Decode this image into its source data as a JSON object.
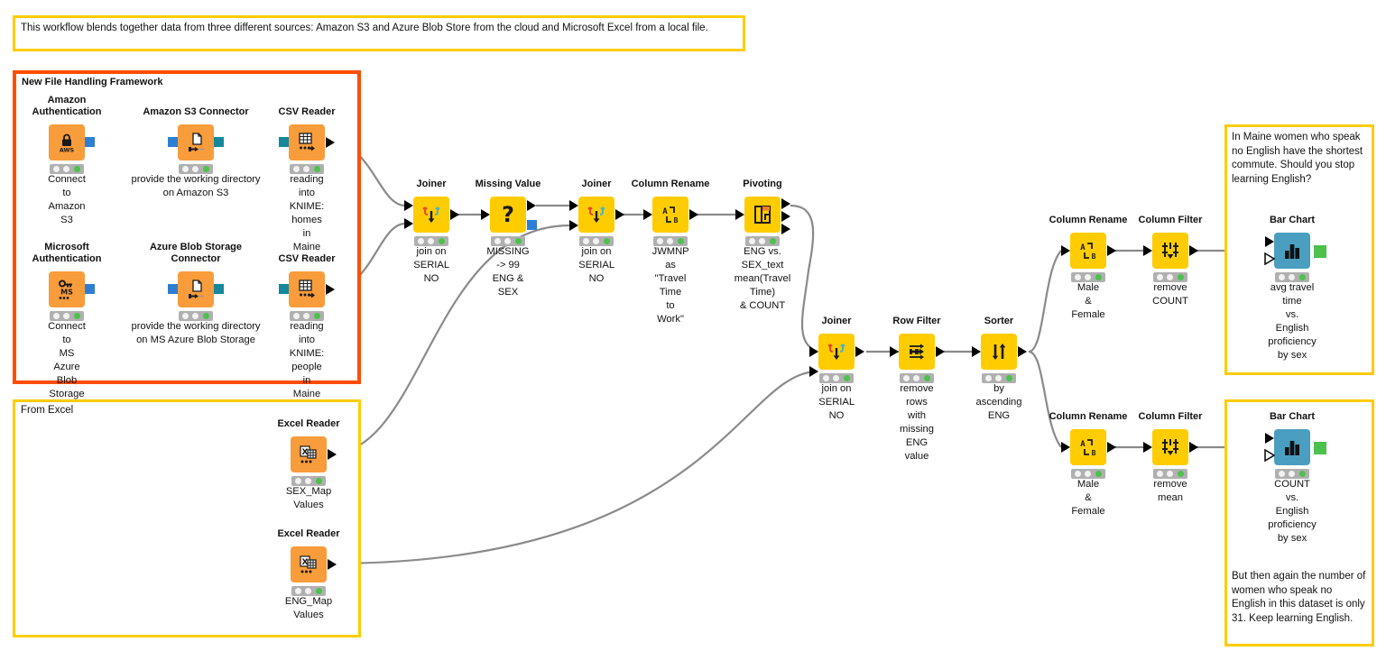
{
  "workflow": {
    "top_note": "This workflow blends together data from three different sources: Amazon S3 and Azure Blob Store from the cloud and Microsoft Excel from a local file.",
    "groups": [
      {
        "id": "file-handling",
        "title": "New File Handling Framework",
        "border_color": "#FF4D00"
      },
      {
        "id": "from-excel",
        "title": "From Excel",
        "border_color": "#FFCC00"
      }
    ],
    "notes": {
      "top_right": "In Maine women who speak no English have the shortest commute. Should you stop learning English?",
      "bottom_right": "But then again the number of women who speak no English in this dataset     is only 31. Keep learning English."
    },
    "nodes": [
      {
        "id": "amazon-auth",
        "title": "Amazon Authentication",
        "desc": "Connect to\nAmazon S3",
        "icon": "aws-lock-icon",
        "color": "orange"
      },
      {
        "id": "s3-connector",
        "title": "Amazon S3 Connector",
        "desc": "provide the working directory\non  Amazon S3",
        "icon": "file-connector-icon",
        "color": "orange"
      },
      {
        "id": "csv-reader-1",
        "title": "CSV Reader",
        "desc": "reading\ninto KNIME:\nhomes in Maine",
        "icon": "table-arrow-icon",
        "color": "orange"
      },
      {
        "id": "ms-auth",
        "title": "Microsoft Authentication",
        "desc": "Connect to\nMS Azure Blob Storage",
        "icon": "ms-key-icon",
        "color": "orange"
      },
      {
        "id": "blob-connector",
        "title": "Azure Blob Storage Connector",
        "desc": "provide the working directory\non MS Azure Blob Storage",
        "icon": "file-connector-icon",
        "color": "orange"
      },
      {
        "id": "csv-reader-2",
        "title": "CSV Reader",
        "desc": "reading\ninto KNIME:\npeople in Maine",
        "icon": "table-arrow-icon",
        "color": "orange"
      },
      {
        "id": "joiner-1",
        "title": "Joiner",
        "desc": "join on\nSERIAL NO",
        "icon": "joiner-icon",
        "color": "yellow"
      },
      {
        "id": "missing-value",
        "title": "Missing Value",
        "desc": "MISSING -> 99\nENG & SEX",
        "icon": "question-icon",
        "color": "yellow"
      },
      {
        "id": "joiner-2",
        "title": "Joiner",
        "desc": "join on\nSERIAL NO",
        "icon": "joiner-icon",
        "color": "yellow"
      },
      {
        "id": "col-rename-1",
        "title": "Column Rename",
        "desc": "JWMNP as\n\"Travel Time\nto Work\"",
        "icon": "ab-rename-icon",
        "color": "yellow"
      },
      {
        "id": "pivoting",
        "title": "Pivoting",
        "desc": "ENG vs.\nSEX_text\nmean(Travel Time)\n& COUNT",
        "icon": "pivot-icon",
        "color": "yellow"
      },
      {
        "id": "excel-reader-1",
        "title": "Excel Reader",
        "desc": "SEX_Map\nValues",
        "icon": "excel-icon",
        "color": "orange"
      },
      {
        "id": "excel-reader-2",
        "title": "Excel Reader",
        "desc": "ENG_Map\nValues",
        "icon": "excel-icon",
        "color": "orange"
      },
      {
        "id": "joiner-3",
        "title": "Joiner",
        "desc": "join on\nSERIAL NO",
        "icon": "joiner-icon",
        "color": "yellow"
      },
      {
        "id": "row-filter",
        "title": "Row Filter",
        "desc": "remove rows\nwith\nmissing ENG\nvalue",
        "icon": "row-filter-icon",
        "color": "yellow"
      },
      {
        "id": "sorter",
        "title": "Sorter",
        "desc": "by ascending\nENG",
        "icon": "sorter-icon",
        "color": "yellow"
      },
      {
        "id": "col-rename-2",
        "title": "Column Rename",
        "desc": "Male\n& Female",
        "icon": "ab-rename-icon",
        "color": "yellow"
      },
      {
        "id": "col-filter-1",
        "title": "Column Filter",
        "desc": "remove COUNT",
        "icon": "column-filter-icon",
        "color": "yellow"
      },
      {
        "id": "bar-chart-1",
        "title": "Bar Chart",
        "desc": "avg travel time\nvs.\nEnglish proficiency\nby sex",
        "icon": "bar-chart-icon",
        "color": "blue"
      },
      {
        "id": "col-rename-3",
        "title": "Column Rename",
        "desc": "Male\n& Female",
        "icon": "ab-rename-icon",
        "color": "yellow"
      },
      {
        "id": "col-filter-2",
        "title": "Column Filter",
        "desc": "remove mean",
        "icon": "column-filter-icon",
        "color": "yellow"
      },
      {
        "id": "bar-chart-2",
        "title": "Bar Chart",
        "desc": "COUNT\nvs.\nEnglish proficiency\nby sex",
        "icon": "bar-chart-icon",
        "color": "blue"
      }
    ],
    "colors": {
      "node_yellow": "#FFCC00",
      "node_orange": "#F89C3C",
      "node_blue": "#4A9EC0",
      "group_orange_border": "#FF4D00",
      "group_yellow_border": "#FFCC00",
      "status_green": "#4CC14C",
      "wire": "#8A8A8A",
      "port_blue": "#2E7FD4",
      "port_teal": "#17879B"
    }
  }
}
